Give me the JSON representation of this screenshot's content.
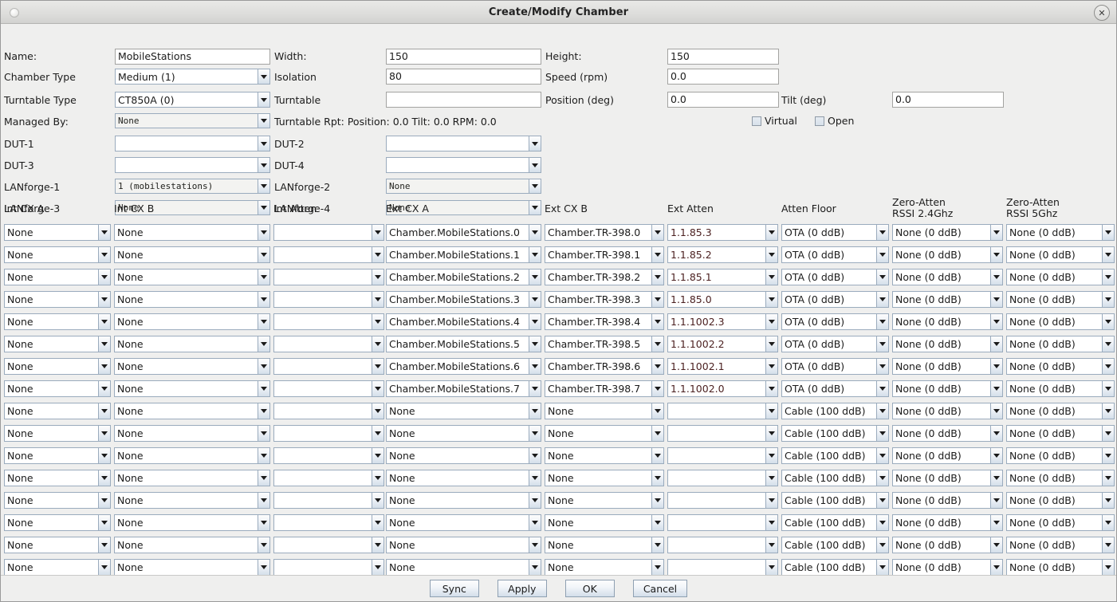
{
  "window": {
    "title": "Create/Modify Chamber",
    "close_label": "✕",
    "icon": "window-icon"
  },
  "top_form": {
    "name_label": "Name:",
    "name_value": "MobileStations",
    "width_label": "Width:",
    "width_value": "150",
    "height_label": "Height:",
    "height_value": "150",
    "chamber_type_label": "Chamber Type",
    "chamber_type_value": "Medium (1)",
    "isolation_label": "Isolation",
    "isolation_value": "80",
    "speed_label": "Speed (rpm)",
    "speed_value": "0.0",
    "turntable_type_label": "Turntable Type",
    "turntable_type_value": "CT850A (0)",
    "turntable_label": "Turntable",
    "turntable_value": "",
    "position_label": "Position (deg)",
    "position_value": "0.0",
    "tilt_label": "Tilt (deg)",
    "tilt_value": "0.0",
    "managed_by_label": "Managed By:",
    "managed_by_value": "None",
    "turntable_rpt": "Turntable Rpt: Position: 0.0 Tilt: 0.0 RPM: 0.0",
    "virtual_label": "Virtual",
    "virtual_checked": false,
    "open_label": "Open",
    "open_checked": false,
    "dut1_label": "DUT-1",
    "dut1_value": "",
    "dut2_label": "DUT-2",
    "dut2_value": "",
    "dut3_label": "DUT-3",
    "dut3_value": "",
    "dut4_label": "DUT-4",
    "dut4_value": "",
    "lanforge1_label": "LANforge-1",
    "lanforge1_value": "1 (mobilestations)",
    "lanforge2_label": "LANforge-2",
    "lanforge2_value": "None",
    "lanforge3_label": "LANforge-3",
    "lanforge3_value": "None",
    "lanforge4_label": "LANforge-4",
    "lanforge4_value": "None"
  },
  "table": {
    "headers": [
      "Int CX A",
      "Int CX B",
      "Int Atten",
      "Ext CX A",
      "Ext CX B",
      "Ext Atten",
      "Atten Floor",
      "Zero-Atten\nRSSI 2.4Ghz",
      "Zero-Atten\nRSSI 5Ghz"
    ],
    "rows": [
      {
        "int_cx_a": "None",
        "int_cx_b": "None",
        "int_atten": "",
        "ext_cx_a": "Chamber.MobileStations.0",
        "ext_cx_b": "Chamber.TR-398.0",
        "ext_atten": "1.1.85.3",
        "atten_floor": "OTA (0 ddB)",
        "zero_24": "None (0 ddB)",
        "zero_5": "None (0 ddB)"
      },
      {
        "int_cx_a": "None",
        "int_cx_b": "None",
        "int_atten": "",
        "ext_cx_a": "Chamber.MobileStations.1",
        "ext_cx_b": "Chamber.TR-398.1",
        "ext_atten": "1.1.85.2",
        "atten_floor": "OTA (0 ddB)",
        "zero_24": "None (0 ddB)",
        "zero_5": "None (0 ddB)"
      },
      {
        "int_cx_a": "None",
        "int_cx_b": "None",
        "int_atten": "",
        "ext_cx_a": "Chamber.MobileStations.2",
        "ext_cx_b": "Chamber.TR-398.2",
        "ext_atten": "1.1.85.1",
        "atten_floor": "OTA (0 ddB)",
        "zero_24": "None (0 ddB)",
        "zero_5": "None (0 ddB)"
      },
      {
        "int_cx_a": "None",
        "int_cx_b": "None",
        "int_atten": "",
        "ext_cx_a": "Chamber.MobileStations.3",
        "ext_cx_b": "Chamber.TR-398.3",
        "ext_atten": "1.1.85.0",
        "atten_floor": "OTA (0 ddB)",
        "zero_24": "None (0 ddB)",
        "zero_5": "None (0 ddB)"
      },
      {
        "int_cx_a": "None",
        "int_cx_b": "None",
        "int_atten": "",
        "ext_cx_a": "Chamber.MobileStations.4",
        "ext_cx_b": "Chamber.TR-398.4",
        "ext_atten": "1.1.1002.3",
        "atten_floor": "OTA (0 ddB)",
        "zero_24": "None (0 ddB)",
        "zero_5": "None (0 ddB)"
      },
      {
        "int_cx_a": "None",
        "int_cx_b": "None",
        "int_atten": "",
        "ext_cx_a": "Chamber.MobileStations.5",
        "ext_cx_b": "Chamber.TR-398.5",
        "ext_atten": "1.1.1002.2",
        "atten_floor": "OTA (0 ddB)",
        "zero_24": "None (0 ddB)",
        "zero_5": "None (0 ddB)"
      },
      {
        "int_cx_a": "None",
        "int_cx_b": "None",
        "int_atten": "",
        "ext_cx_a": "Chamber.MobileStations.6",
        "ext_cx_b": "Chamber.TR-398.6",
        "ext_atten": "1.1.1002.1",
        "atten_floor": "OTA (0 ddB)",
        "zero_24": "None (0 ddB)",
        "zero_5": "None (0 ddB)"
      },
      {
        "int_cx_a": "None",
        "int_cx_b": "None",
        "int_atten": "",
        "ext_cx_a": "Chamber.MobileStations.7",
        "ext_cx_b": "Chamber.TR-398.7",
        "ext_atten": "1.1.1002.0",
        "atten_floor": "OTA (0 ddB)",
        "zero_24": "None (0 ddB)",
        "zero_5": "None (0 ddB)"
      },
      {
        "int_cx_a": "None",
        "int_cx_b": "None",
        "int_atten": "",
        "ext_cx_a": "None",
        "ext_cx_b": "None",
        "ext_atten": "",
        "atten_floor": "Cable (100 ddB)",
        "zero_24": "None (0 ddB)",
        "zero_5": "None (0 ddB)"
      },
      {
        "int_cx_a": "None",
        "int_cx_b": "None",
        "int_atten": "",
        "ext_cx_a": "None",
        "ext_cx_b": "None",
        "ext_atten": "",
        "atten_floor": "Cable (100 ddB)",
        "zero_24": "None (0 ddB)",
        "zero_5": "None (0 ddB)"
      },
      {
        "int_cx_a": "None",
        "int_cx_b": "None",
        "int_atten": "",
        "ext_cx_a": "None",
        "ext_cx_b": "None",
        "ext_atten": "",
        "atten_floor": "Cable (100 ddB)",
        "zero_24": "None (0 ddB)",
        "zero_5": "None (0 ddB)"
      },
      {
        "int_cx_a": "None",
        "int_cx_b": "None",
        "int_atten": "",
        "ext_cx_a": "None",
        "ext_cx_b": "None",
        "ext_atten": "",
        "atten_floor": "Cable (100 ddB)",
        "zero_24": "None (0 ddB)",
        "zero_5": "None (0 ddB)"
      },
      {
        "int_cx_a": "None",
        "int_cx_b": "None",
        "int_atten": "",
        "ext_cx_a": "None",
        "ext_cx_b": "None",
        "ext_atten": "",
        "atten_floor": "Cable (100 ddB)",
        "zero_24": "None (0 ddB)",
        "zero_5": "None (0 ddB)"
      },
      {
        "int_cx_a": "None",
        "int_cx_b": "None",
        "int_atten": "",
        "ext_cx_a": "None",
        "ext_cx_b": "None",
        "ext_atten": "",
        "atten_floor": "Cable (100 ddB)",
        "zero_24": "None (0 ddB)",
        "zero_5": "None (0 ddB)"
      },
      {
        "int_cx_a": "None",
        "int_cx_b": "None",
        "int_atten": "",
        "ext_cx_a": "None",
        "ext_cx_b": "None",
        "ext_atten": "",
        "atten_floor": "Cable (100 ddB)",
        "zero_24": "None (0 ddB)",
        "zero_5": "None (0 ddB)"
      },
      {
        "int_cx_a": "None",
        "int_cx_b": "None",
        "int_atten": "",
        "ext_cx_a": "None",
        "ext_cx_b": "None",
        "ext_atten": "",
        "atten_floor": "Cable (100 ddB)",
        "zero_24": "None (0 ddB)",
        "zero_5": "None (0 ddB)"
      }
    ]
  },
  "buttons": {
    "sync": "Sync",
    "apply": "Apply",
    "ok": "OK",
    "cancel": "Cancel"
  },
  "colors": {
    "window_bg": "#efefee",
    "titlebar": "#dededc",
    "field_border": "#9aabbd",
    "numeric_text": "#4a1f1f"
  }
}
